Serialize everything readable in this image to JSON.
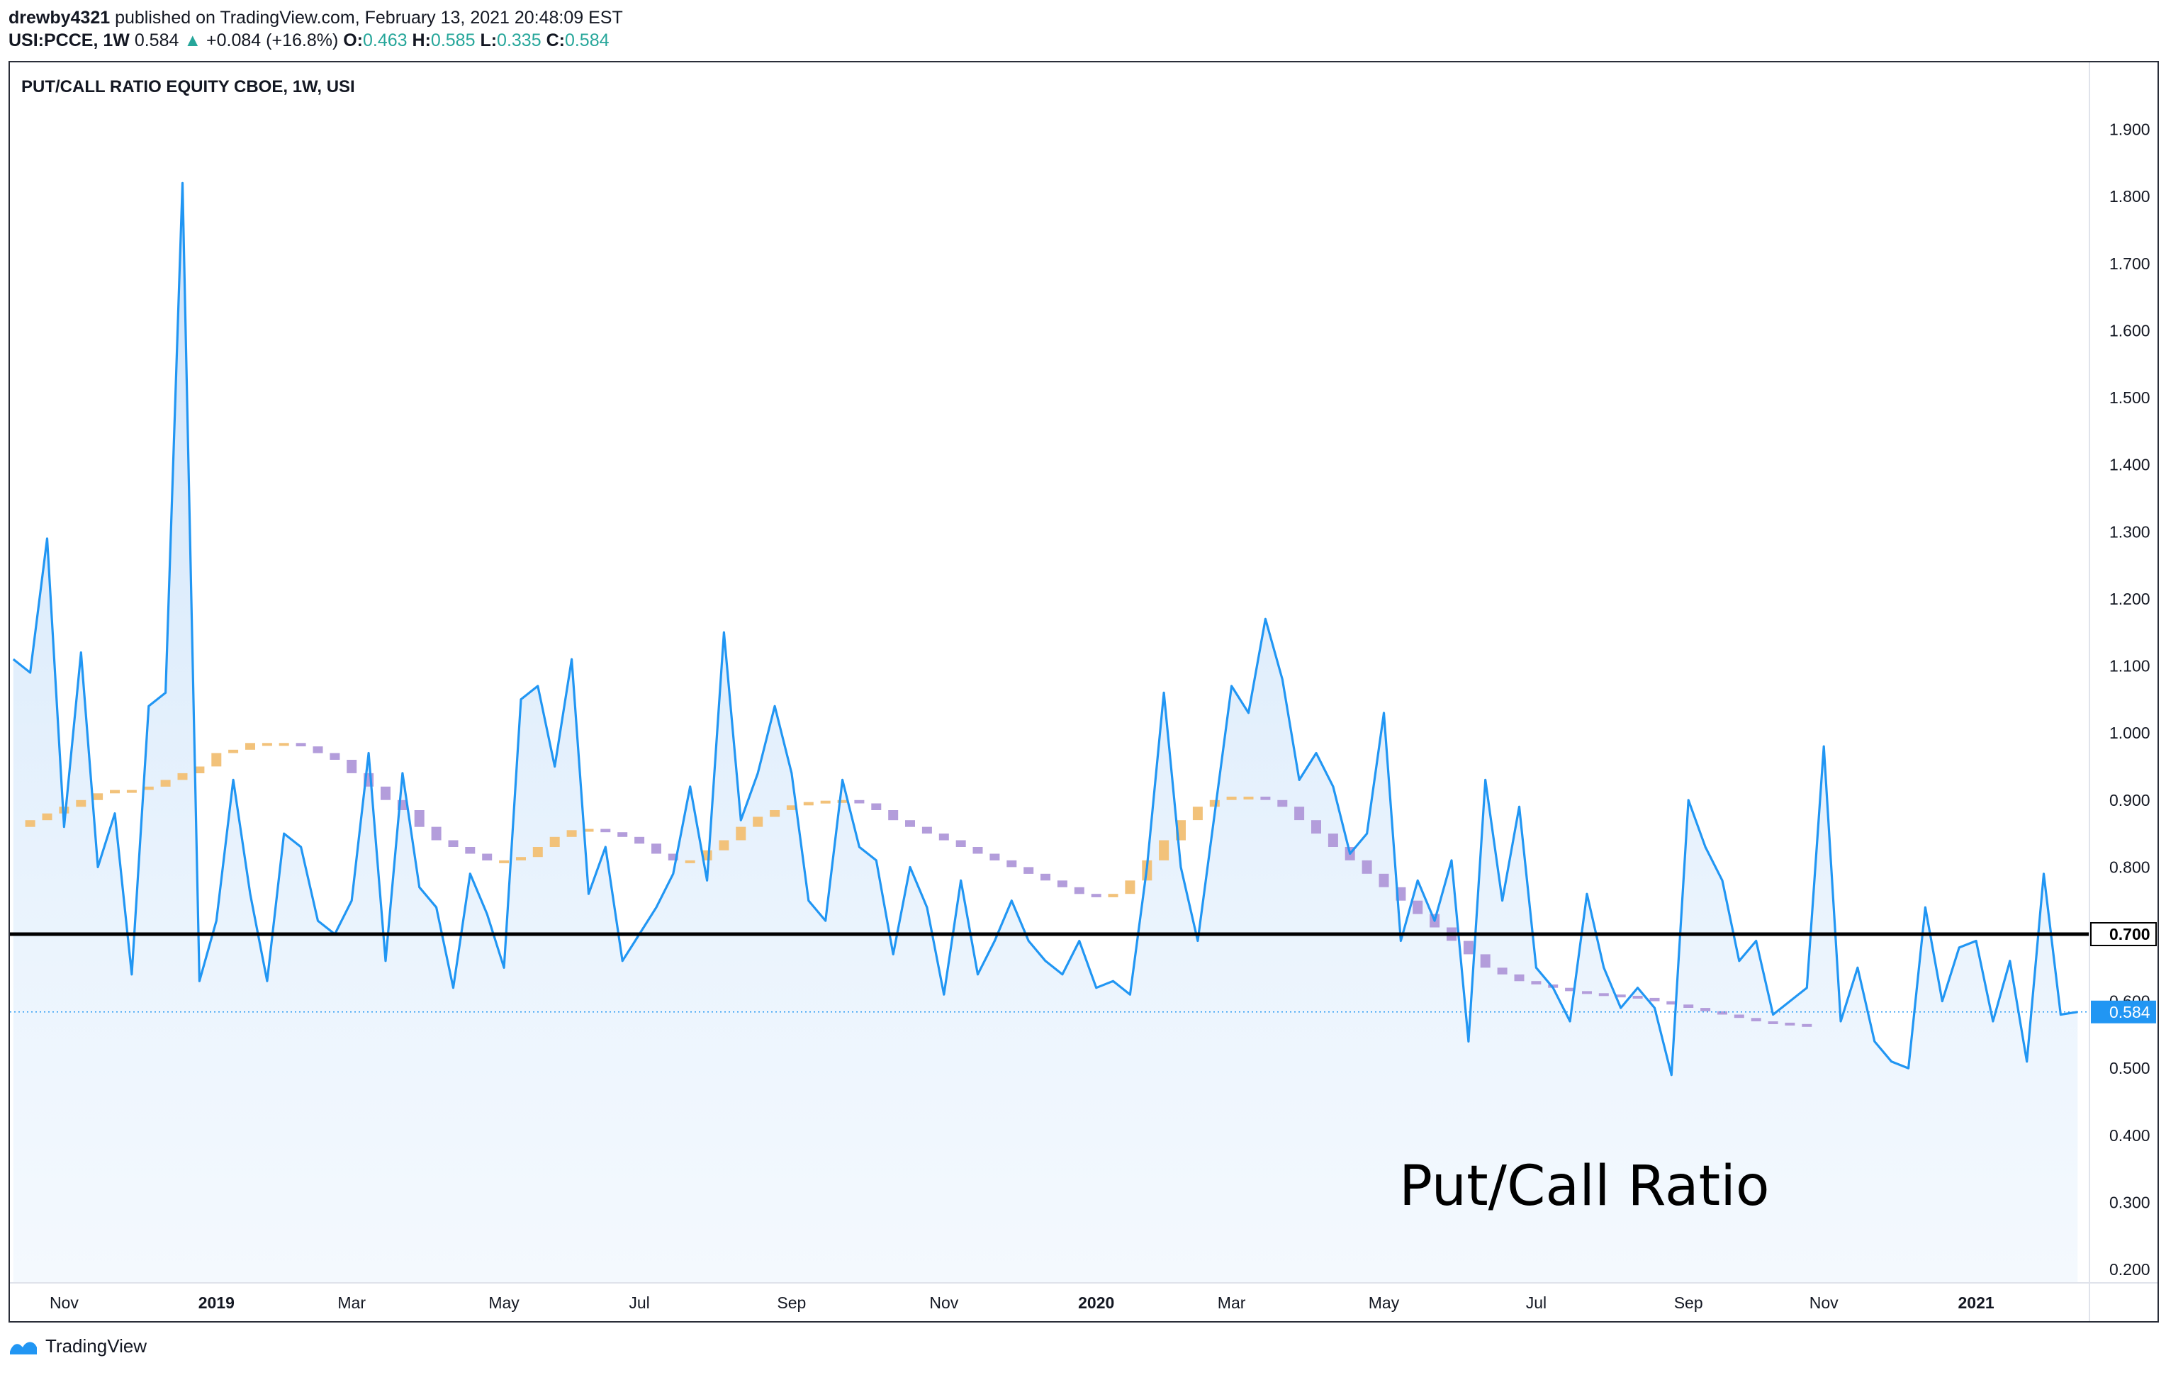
{
  "header": {
    "author": "drewby4321",
    "published_text": "published on TradingView.com, February 13, 2021 20:48:09 EST"
  },
  "ohlc": {
    "symbol": "USI:PCCE, 1W",
    "last": "0.584",
    "change": "+0.084 (+16.8%)",
    "o_label": "O:",
    "o": "0.463",
    "h_label": "H:",
    "h": "0.585",
    "l_label": "L:",
    "l": "0.335",
    "c_label": "C:",
    "c": "0.584"
  },
  "footer": {
    "brand": "TradingView"
  },
  "icons": {
    "arrow": "up-triangle-icon",
    "logo": "tradingview-logo-icon"
  },
  "colors": {
    "line": "#2196f3",
    "area_top": "#cfe5fb",
    "baseline": "#000000",
    "ma_up": "#f2c27a",
    "ma_down": "#b39ddb",
    "price_tag": "#2196f3",
    "up_text": "#26a69a"
  },
  "chart_data": {
    "type": "line",
    "title": "PUT/CALL RATIO EQUITY CBOE, 1W, USI",
    "annotation": "Put/Call Ratio",
    "y_ticks": [
      "1.900",
      "1.800",
      "1.700",
      "1.600",
      "1.500",
      "1.400",
      "1.300",
      "1.200",
      "1.100",
      "1.000",
      "0.900",
      "0.800",
      "0.700",
      "0.600",
      "0.500",
      "0.400",
      "0.300",
      "0.200"
    ],
    "y_tick_values": [
      1.9,
      1.8,
      1.7,
      1.6,
      1.5,
      1.4,
      1.3,
      1.2,
      1.1,
      1.0,
      0.9,
      0.8,
      0.7,
      0.6,
      0.5,
      0.4,
      0.3,
      0.2
    ],
    "ylim": [
      0.18,
      2.0
    ],
    "x_labels": [
      {
        "label": "Nov",
        "bold": false,
        "index": 3
      },
      {
        "label": "2019",
        "bold": true,
        "index": 12
      },
      {
        "label": "Mar",
        "bold": false,
        "index": 20
      },
      {
        "label": "May",
        "bold": false,
        "index": 29
      },
      {
        "label": "Jul",
        "bold": false,
        "index": 37
      },
      {
        "label": "Sep",
        "bold": false,
        "index": 46
      },
      {
        "label": "Nov",
        "bold": false,
        "index": 55
      },
      {
        "label": "2020",
        "bold": true,
        "index": 64
      },
      {
        "label": "Mar",
        "bold": false,
        "index": 72
      },
      {
        "label": "May",
        "bold": false,
        "index": 81
      },
      {
        "label": "Jul",
        "bold": false,
        "index": 90
      },
      {
        "label": "Sep",
        "bold": false,
        "index": 99
      },
      {
        "label": "Nov",
        "bold": false,
        "index": 107
      },
      {
        "label": "2021",
        "bold": true,
        "index": 116
      }
    ],
    "x_index_range": [
      -0.2,
      122.7
    ],
    "series": [
      {
        "kind": "line",
        "values": [
          1.11,
          1.09,
          1.29,
          0.86,
          1.12,
          0.8,
          0.88,
          0.64,
          1.04,
          1.06,
          1.82,
          0.63,
          0.72,
          0.93,
          0.76,
          0.63,
          0.85,
          0.83,
          0.72,
          0.7,
          0.75,
          0.97,
          0.66,
          0.94,
          0.77,
          0.74,
          0.62,
          0.79,
          0.73,
          0.65,
          1.05,
          1.07,
          0.95,
          1.11,
          0.76,
          0.83,
          0.66,
          0.7,
          0.74,
          0.79,
          0.92,
          0.78,
          1.15,
          0.87,
          0.94,
          1.04,
          0.94,
          0.75,
          0.72,
          0.93,
          0.83,
          0.81,
          0.67,
          0.8,
          0.74,
          0.61,
          0.78,
          0.64,
          0.69,
          0.75,
          0.69,
          0.66,
          0.64,
          0.69,
          0.62,
          0.63,
          0.61,
          0.8,
          1.06,
          0.8,
          0.69,
          0.88,
          1.07,
          1.03,
          1.17,
          1.08,
          0.93,
          0.97,
          0.92,
          0.82,
          0.85,
          1.03,
          0.69,
          0.78,
          0.72,
          0.81,
          0.54,
          0.93,
          0.75,
          0.89,
          0.65,
          0.62,
          0.57,
          0.76,
          0.65,
          0.59,
          0.62,
          0.59,
          0.49,
          0.9,
          0.83,
          0.78,
          0.66,
          0.69,
          0.58,
          0.6,
          0.62,
          0.98,
          0.57,
          0.65,
          0.54,
          0.51,
          0.5,
          0.74,
          0.6,
          0.68,
          0.69,
          0.57,
          0.66,
          0.51,
          0.79,
          0.58,
          0.584
        ]
      },
      {
        "kind": "moving_average_bars",
        "values": [
          0.86,
          0.87,
          0.88,
          0.89,
          0.9,
          0.91,
          0.915,
          0.915,
          0.92,
          0.93,
          0.94,
          0.95,
          0.97,
          0.975,
          0.985,
          0.985,
          0.985,
          0.98,
          0.97,
          0.96,
          0.94,
          0.92,
          0.9,
          0.885,
          0.86,
          0.84,
          0.83,
          0.82,
          0.81,
          0.81,
          0.815,
          0.83,
          0.845,
          0.855,
          0.857,
          0.852,
          0.845,
          0.835,
          0.82,
          0.81,
          0.81,
          0.825,
          0.84,
          0.86,
          0.875,
          0.885,
          0.892,
          0.897,
          0.899,
          0.9,
          0.895,
          0.885,
          0.87,
          0.86,
          0.85,
          0.84,
          0.83,
          0.82,
          0.81,
          0.8,
          0.79,
          0.78,
          0.77,
          0.76,
          0.755,
          0.76,
          0.78,
          0.81,
          0.84,
          0.87,
          0.89,
          0.9,
          0.905,
          0.905,
          0.9,
          0.89,
          0.87,
          0.85,
          0.83,
          0.81,
          0.79,
          0.77,
          0.75,
          0.73,
          0.71,
          0.69,
          0.67,
          0.65,
          0.64,
          0.63,
          0.625,
          0.62,
          0.615,
          0.612,
          0.61,
          0.608,
          0.605,
          0.6,
          0.595,
          0.59,
          0.585,
          0.58,
          0.575,
          0.57,
          0.568,
          0.566,
          0.565
        ]
      }
    ],
    "hlines": [
      {
        "value": 0.7,
        "label": "0.700"
      }
    ],
    "last_value": {
      "value": 0.584,
      "label": "0.584"
    },
    "grid": false,
    "legend": "none"
  }
}
